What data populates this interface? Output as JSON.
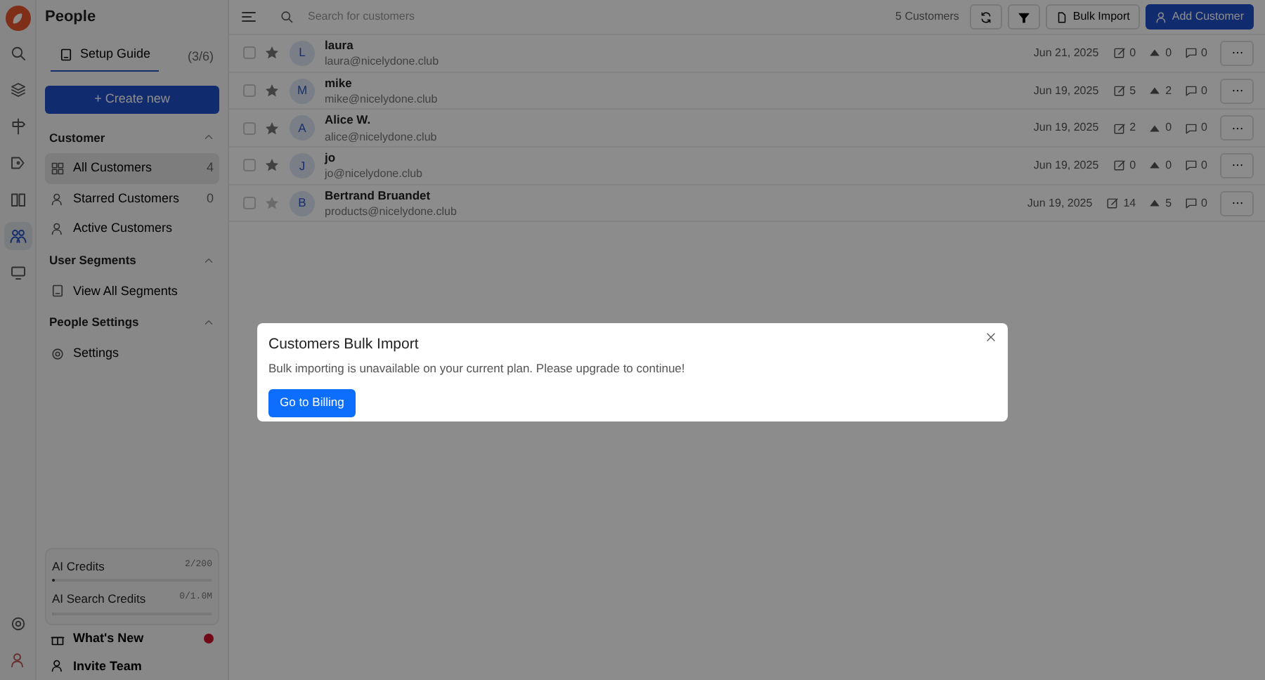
{
  "app": {
    "title": "People"
  },
  "rail": {
    "items": [
      {
        "selected": false
      },
      {
        "selected": false
      },
      {
        "selected": false
      },
      {
        "selected": false
      },
      {
        "selected": false
      },
      {
        "selected": true
      },
      {
        "selected": false
      }
    ]
  },
  "setup_guide": {
    "label": "Setup Guide",
    "progress": "(3/6)"
  },
  "create_button": "+ Create new",
  "sections": [
    {
      "title": "Customer",
      "expanded": true,
      "items": [
        {
          "label": "All Customers",
          "count": "4",
          "selected": true
        },
        {
          "label": "Starred Customers",
          "count": "0",
          "selected": false
        },
        {
          "label": "Active Customers",
          "selected": false
        }
      ]
    },
    {
      "title": "User Segments",
      "expanded": true,
      "items": [
        {
          "label": "View All Segments",
          "selected": false
        }
      ]
    },
    {
      "title": "People Settings",
      "expanded": true,
      "items": [
        {
          "label": "Settings",
          "selected": false
        }
      ]
    }
  ],
  "credits": [
    {
      "label": "AI Credits",
      "reading": "2/200",
      "level": 0.01
    },
    {
      "label": "AI Search Credits",
      "reading": "0/1.0M",
      "level": 0
    }
  ],
  "footer_links": [
    {
      "label": "What's New",
      "unread": true
    },
    {
      "label": "Invite Team",
      "unread": false
    }
  ],
  "toolbar": {
    "search_placeholder": "Search for customers",
    "count": "5 Customers",
    "bulk_import": "Bulk Import",
    "add_customer": "Add Customer"
  },
  "customers": [
    {
      "checked": false,
      "starred": true,
      "initial": "L",
      "name": "laura",
      "email": "laura@nicelydone.club",
      "date": "Jun 21, 2025",
      "notes": "0",
      "upvotes": "0",
      "comments": "0"
    },
    {
      "checked": false,
      "starred": true,
      "initial": "M",
      "name": "mike",
      "email": "mike@nicelydone.club",
      "date": "Jun 19, 2025",
      "notes": "5",
      "upvotes": "2",
      "comments": "0"
    },
    {
      "checked": false,
      "starred": true,
      "initial": "A",
      "name": "Alice W.",
      "email": "alice@nicelydone.club",
      "date": "Jun 19, 2025",
      "notes": "2",
      "upvotes": "0",
      "comments": "0"
    },
    {
      "checked": false,
      "starred": true,
      "initial": "J",
      "name": "jo",
      "email": "jo@nicelydone.club",
      "date": "Jun 19, 2025",
      "notes": "0",
      "upvotes": "0",
      "comments": "0"
    },
    {
      "checked": false,
      "starred": false,
      "initial": "B",
      "name": "Bertrand Bruandet",
      "email": "products@nicelydone.club",
      "date": "Jun 19, 2025",
      "notes": "14",
      "upvotes": "5",
      "comments": "0"
    }
  ],
  "modal": {
    "title": "Customers Bulk Import",
    "message": "Bulk importing is unavailable on your current plan. Please upgrade to continue!",
    "button": "Go to Billing"
  }
}
